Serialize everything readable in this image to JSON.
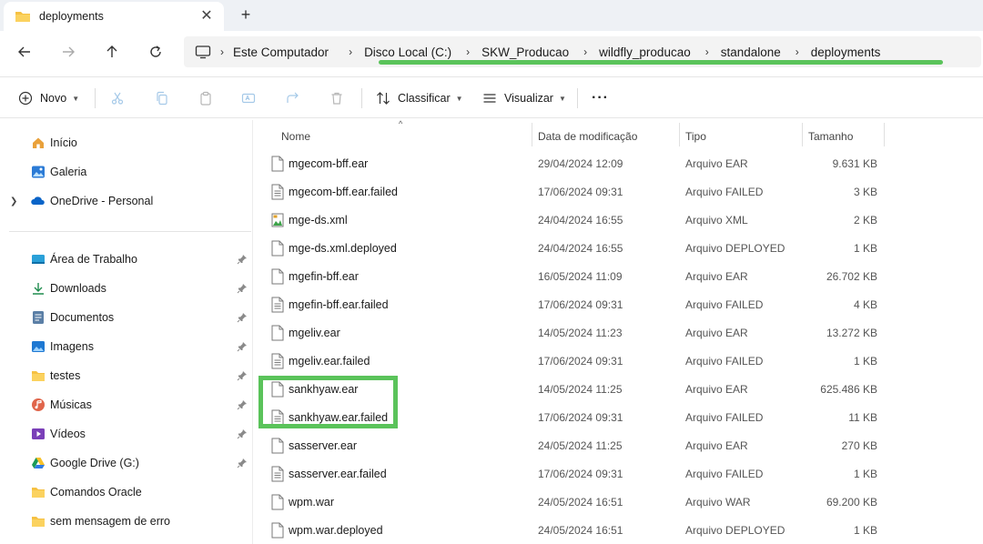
{
  "tab": {
    "title": "deployments",
    "close": "✕",
    "new_tab": "+"
  },
  "breadcrumb": [
    "Este Computador",
    "Disco Local (C:)",
    "SKW_Producao",
    "wildfly_producao",
    "standalone",
    "deployments"
  ],
  "toolbar": {
    "new_label": "Novo",
    "sort_label": "Classificar",
    "view_label": "Visualizar",
    "more_label": "···"
  },
  "sidebar": {
    "top_items": [
      {
        "label": "Início",
        "icon": "home-icon"
      },
      {
        "label": "Galeria",
        "icon": "gallery-icon"
      },
      {
        "label": "OneDrive - Personal",
        "icon": "onedrive-icon"
      }
    ],
    "quick_items": [
      {
        "label": "Área de Trabalho",
        "icon": "desktop-icon",
        "pinned": true
      },
      {
        "label": "Downloads",
        "icon": "download-icon",
        "pinned": true
      },
      {
        "label": "Documentos",
        "icon": "documents-icon",
        "pinned": true
      },
      {
        "label": "Imagens",
        "icon": "pictures-icon",
        "pinned": true
      },
      {
        "label": "testes",
        "icon": "folder-icon",
        "pinned": true
      },
      {
        "label": "Músicas",
        "icon": "music-icon",
        "pinned": true
      },
      {
        "label": "Vídeos",
        "icon": "videos-icon",
        "pinned": true
      },
      {
        "label": "Google Drive (G:)",
        "icon": "google-drive-icon",
        "pinned": true
      },
      {
        "label": "Comandos Oracle",
        "icon": "folder-icon",
        "pinned": false
      },
      {
        "label": "sem mensagem de erro",
        "icon": "folder-icon",
        "pinned": false
      }
    ]
  },
  "columns": {
    "name": "Nome",
    "date": "Data de modificação",
    "type": "Tipo",
    "size": "Tamanho"
  },
  "files": [
    {
      "name": "mgecom-bff.ear",
      "date": "29/04/2024 12:09",
      "type": "Arquivo EAR",
      "size": "9.631 KB",
      "icon": "file-icon"
    },
    {
      "name": "mgecom-bff.ear.failed",
      "date": "17/06/2024 09:31",
      "type": "Arquivo FAILED",
      "size": "3 KB",
      "icon": "text-file-icon"
    },
    {
      "name": "mge-ds.xml",
      "date": "24/04/2024 16:55",
      "type": "Arquivo XML",
      "size": "2 KB",
      "icon": "xml-file-icon"
    },
    {
      "name": "mge-ds.xml.deployed",
      "date": "24/04/2024 16:55",
      "type": "Arquivo DEPLOYED",
      "size": "1 KB",
      "icon": "file-icon"
    },
    {
      "name": "mgefin-bff.ear",
      "date": "16/05/2024 11:09",
      "type": "Arquivo EAR",
      "size": "26.702 KB",
      "icon": "file-icon"
    },
    {
      "name": "mgefin-bff.ear.failed",
      "date": "17/06/2024 09:31",
      "type": "Arquivo FAILED",
      "size": "4 KB",
      "icon": "text-file-icon"
    },
    {
      "name": "mgeliv.ear",
      "date": "14/05/2024 11:23",
      "type": "Arquivo EAR",
      "size": "13.272 KB",
      "icon": "file-icon"
    },
    {
      "name": "mgeliv.ear.failed",
      "date": "17/06/2024 09:31",
      "type": "Arquivo FAILED",
      "size": "1 KB",
      "icon": "text-file-icon"
    },
    {
      "name": "sankhyaw.ear",
      "date": "14/05/2024 11:25",
      "type": "Arquivo EAR",
      "size": "625.486 KB",
      "icon": "file-icon"
    },
    {
      "name": "sankhyaw.ear.failed",
      "date": "17/06/2024 09:31",
      "type": "Arquivo FAILED",
      "size": "11 KB",
      "icon": "text-file-icon"
    },
    {
      "name": "sasserver.ear",
      "date": "24/05/2024 11:25",
      "type": "Arquivo EAR",
      "size": "270 KB",
      "icon": "file-icon"
    },
    {
      "name": "sasserver.ear.failed",
      "date": "17/06/2024 09:31",
      "type": "Arquivo FAILED",
      "size": "1 KB",
      "icon": "text-file-icon"
    },
    {
      "name": "wpm.war",
      "date": "24/05/2024 16:51",
      "type": "Arquivo WAR",
      "size": "69.200 KB",
      "icon": "file-icon"
    },
    {
      "name": "wpm.war.deployed",
      "date": "24/05/2024 16:51",
      "type": "Arquivo DEPLOYED",
      "size": "1 KB",
      "icon": "file-icon"
    }
  ],
  "colors": {
    "highlight": "#5ac35a",
    "folder": "#f6c143",
    "accent": "#0067c0"
  }
}
